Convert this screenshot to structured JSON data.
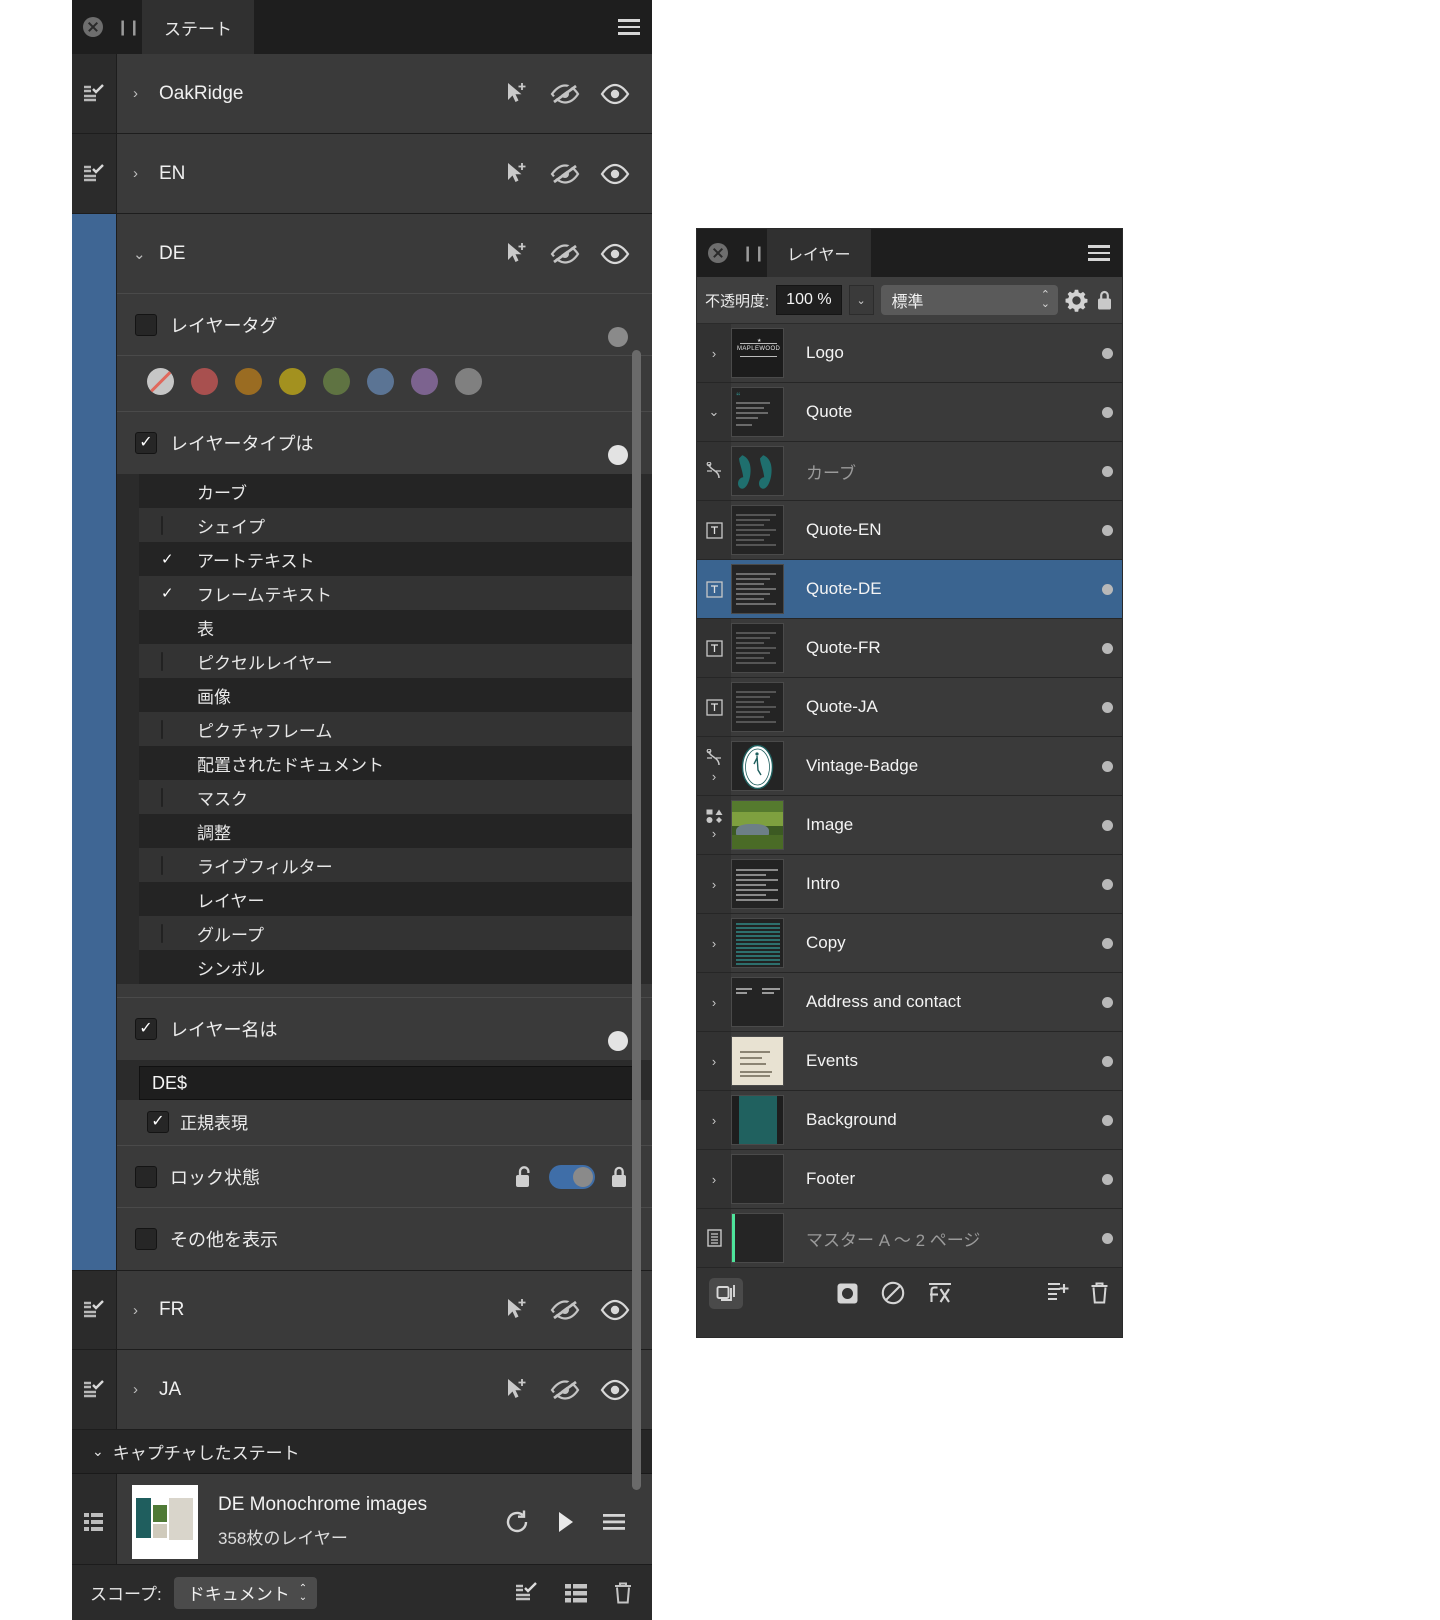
{
  "states_panel": {
    "tab_label": "ステート",
    "close_icon": "close-circle-icon",
    "menu_icon": "hamburger-menu-icon",
    "rows": [
      {
        "name": "OakRidge",
        "expanded": false,
        "chevron": "›"
      },
      {
        "name": "EN",
        "expanded": false,
        "chevron": "›"
      },
      {
        "name": "DE",
        "expanded": true,
        "chevron": "⌄"
      }
    ],
    "tail_rows": [
      {
        "name": "FR",
        "expanded": false,
        "chevron": "›"
      },
      {
        "name": "JA",
        "expanded": false,
        "chevron": "›"
      }
    ],
    "row_icons": [
      "select-cursor-icon",
      "hide-eye-icon",
      "show-eye-icon"
    ],
    "layer_tag": {
      "label": "レイヤータグ",
      "checked": false,
      "toggle_state": "mid",
      "swatches": [
        {
          "name": "none",
          "color": "#c6c6c6"
        },
        {
          "name": "red",
          "color": "#a8504f"
        },
        {
          "name": "orange",
          "color": "#9a6c22"
        },
        {
          "name": "yellow",
          "color": "#a3911f"
        },
        {
          "name": "green",
          "color": "#5f7342"
        },
        {
          "name": "blue",
          "color": "#5b7494"
        },
        {
          "name": "purple",
          "color": "#7c638f"
        },
        {
          "name": "gray",
          "color": "#808080"
        }
      ]
    },
    "layer_type": {
      "label": "レイヤータイプは",
      "checked": true,
      "toggle_state": "on",
      "items": [
        {
          "label": "カーブ",
          "checked": false,
          "has_box": false
        },
        {
          "label": "シェイプ",
          "checked": false,
          "has_box": true
        },
        {
          "label": "アートテキスト",
          "checked": true,
          "has_box": false
        },
        {
          "label": "フレームテキスト",
          "checked": true,
          "has_box": false
        },
        {
          "label": "表",
          "checked": false,
          "has_box": false
        },
        {
          "label": "ピクセルレイヤー",
          "checked": false,
          "has_box": true
        },
        {
          "label": "画像",
          "checked": false,
          "has_box": false
        },
        {
          "label": "ピクチャフレーム",
          "checked": false,
          "has_box": true
        },
        {
          "label": "配置されたドキュメント",
          "checked": false,
          "has_box": false
        },
        {
          "label": "マスク",
          "checked": false,
          "has_box": true
        },
        {
          "label": "調整",
          "checked": false,
          "has_box": false
        },
        {
          "label": "ライブフィルター",
          "checked": false,
          "has_box": true
        },
        {
          "label": "レイヤー",
          "checked": false,
          "has_box": false
        },
        {
          "label": "グループ",
          "checked": false,
          "has_box": true
        },
        {
          "label": "シンボル",
          "checked": false,
          "has_box": false
        }
      ]
    },
    "layer_name": {
      "label": "レイヤー名は",
      "checked": true,
      "toggle_state": "on",
      "value": "DE$",
      "regex_label": "正規表現",
      "regex_checked": true
    },
    "lock_state": {
      "label": "ロック状態",
      "checked": false,
      "toggle_state": "mid",
      "unlock_icon": "unlock-icon",
      "lock_icon": "lock-icon"
    },
    "show_others": {
      "label": "その他を表示",
      "checked": false
    },
    "captured": {
      "header": "キャプチャしたステート",
      "chevron": "⌄",
      "item": {
        "title": "DE Monochrome images",
        "subtitle": "358枚のレイヤー",
        "icons": [
          "restore-icon",
          "play-icon",
          "list-menu-icon"
        ]
      }
    },
    "footer": {
      "scope_label": "スコープ:",
      "scope_value": "ドキュメント",
      "tools": [
        "apply-state-icon",
        "list-icon",
        "trash-icon"
      ]
    }
  },
  "layers_panel": {
    "tab_label": "レイヤー",
    "close_icon": "close-circle-icon",
    "menu_icon": "hamburger-menu-icon",
    "opacity": {
      "label": "不透明度:",
      "value": "100 %",
      "dropdown_icon": "chevron-down-icon",
      "blend_mode": "標準",
      "stepper_icon": "stepper-updown-icon",
      "gear_icon": "gear-icon",
      "lock_icon": "lock-icon"
    },
    "accent_selected": "#3a6490",
    "rows": [
      {
        "name": "Logo",
        "chevron": "›",
        "kind": "group",
        "selected": false,
        "dim": false,
        "thumb": "logo",
        "extra_icon": ""
      },
      {
        "name": "Quote",
        "chevron": "⌄",
        "kind": "group",
        "selected": false,
        "dim": false,
        "thumb": "text-doc",
        "extra_icon": ""
      },
      {
        "name": "カーブ",
        "chevron": "",
        "kind": "curve",
        "selected": false,
        "dim": true,
        "thumb": "quotemark",
        "extra_icon": "curve-node-icon",
        "indent": 1
      },
      {
        "name": "Quote-EN",
        "chevron": "",
        "kind": "text",
        "selected": false,
        "dim": false,
        "thumb": "paragraph",
        "extra_icon": "text-frame-icon",
        "indent": 1
      },
      {
        "name": "Quote-DE",
        "chevron": "",
        "kind": "text",
        "selected": true,
        "dim": false,
        "thumb": "paragraph-de",
        "extra_icon": "text-frame-icon",
        "indent": 1
      },
      {
        "name": "Quote-FR",
        "chevron": "",
        "kind": "text",
        "selected": false,
        "dim": false,
        "thumb": "paragraph",
        "extra_icon": "text-frame-icon",
        "indent": 1
      },
      {
        "name": "Quote-JA",
        "chevron": "",
        "kind": "text",
        "selected": false,
        "dim": false,
        "thumb": "paragraph",
        "extra_icon": "text-frame-icon",
        "indent": 1
      },
      {
        "name": "Vintage-Badge",
        "chevron": "›",
        "kind": "curve-group",
        "selected": false,
        "dim": false,
        "thumb": "badge",
        "extra_icon": "curve-node-icon"
      },
      {
        "name": "Image",
        "chevron": "›",
        "kind": "shape-group",
        "selected": false,
        "dim": false,
        "thumb": "photo",
        "extra_icon": "shapes-icon"
      },
      {
        "name": "Intro",
        "chevron": "›",
        "kind": "group",
        "selected": false,
        "dim": false,
        "thumb": "lines",
        "extra_icon": ""
      },
      {
        "name": "Copy",
        "chevron": "›",
        "kind": "group",
        "selected": false,
        "dim": false,
        "thumb": "teal-lines",
        "extra_icon": ""
      },
      {
        "name": "Address and contact",
        "chevron": "›",
        "kind": "group",
        "selected": false,
        "dim": false,
        "thumb": "addr",
        "extra_icon": ""
      },
      {
        "name": "Events",
        "chevron": "›",
        "kind": "group",
        "selected": false,
        "dim": false,
        "thumb": "cream",
        "extra_icon": ""
      },
      {
        "name": "Background",
        "chevron": "›",
        "kind": "group",
        "selected": false,
        "dim": false,
        "thumb": "teal",
        "extra_icon": ""
      },
      {
        "name": "Footer",
        "chevron": "›",
        "kind": "group",
        "selected": false,
        "dim": false,
        "thumb": "dark",
        "extra_icon": ""
      },
      {
        "name": "マスター A 〜 2 ページ",
        "chevron": "",
        "kind": "master",
        "selected": false,
        "dim": true,
        "thumb": "master",
        "extra_icon": "master-page-icon"
      }
    ],
    "footer_tools": {
      "left": "duplicate-layers-icon",
      "center": [
        "mask-icon",
        "adjustment-icon",
        "fx-icon"
      ],
      "right": [
        "add-layer-icon",
        "trash-icon"
      ]
    }
  }
}
